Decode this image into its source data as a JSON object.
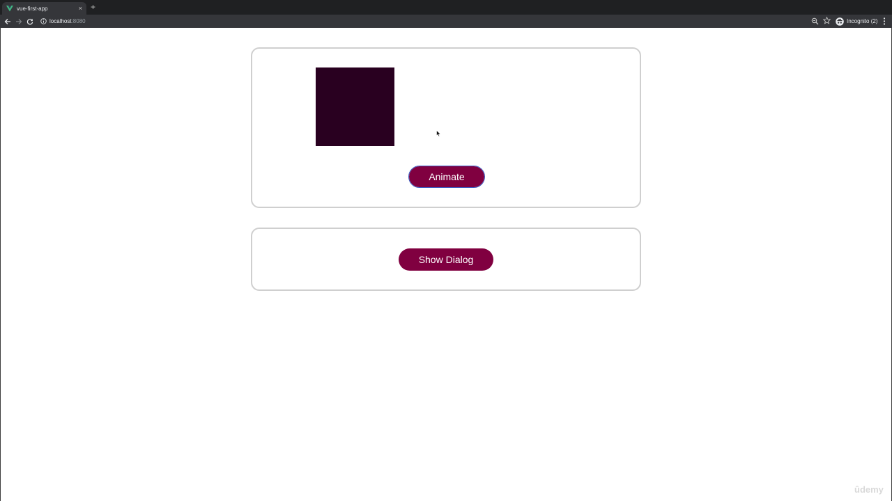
{
  "browser": {
    "tab_title": "vue-first-app",
    "tab_close": "×",
    "new_tab": "+",
    "url_host": "localhost",
    "url_port": ":8080",
    "incognito_label": "Incognito (2)"
  },
  "page": {
    "animate_button": "Animate",
    "show_dialog_button": "Show Dialog",
    "block_color": "#290020",
    "button_color": "#800040"
  },
  "watermark": "ûdemy"
}
